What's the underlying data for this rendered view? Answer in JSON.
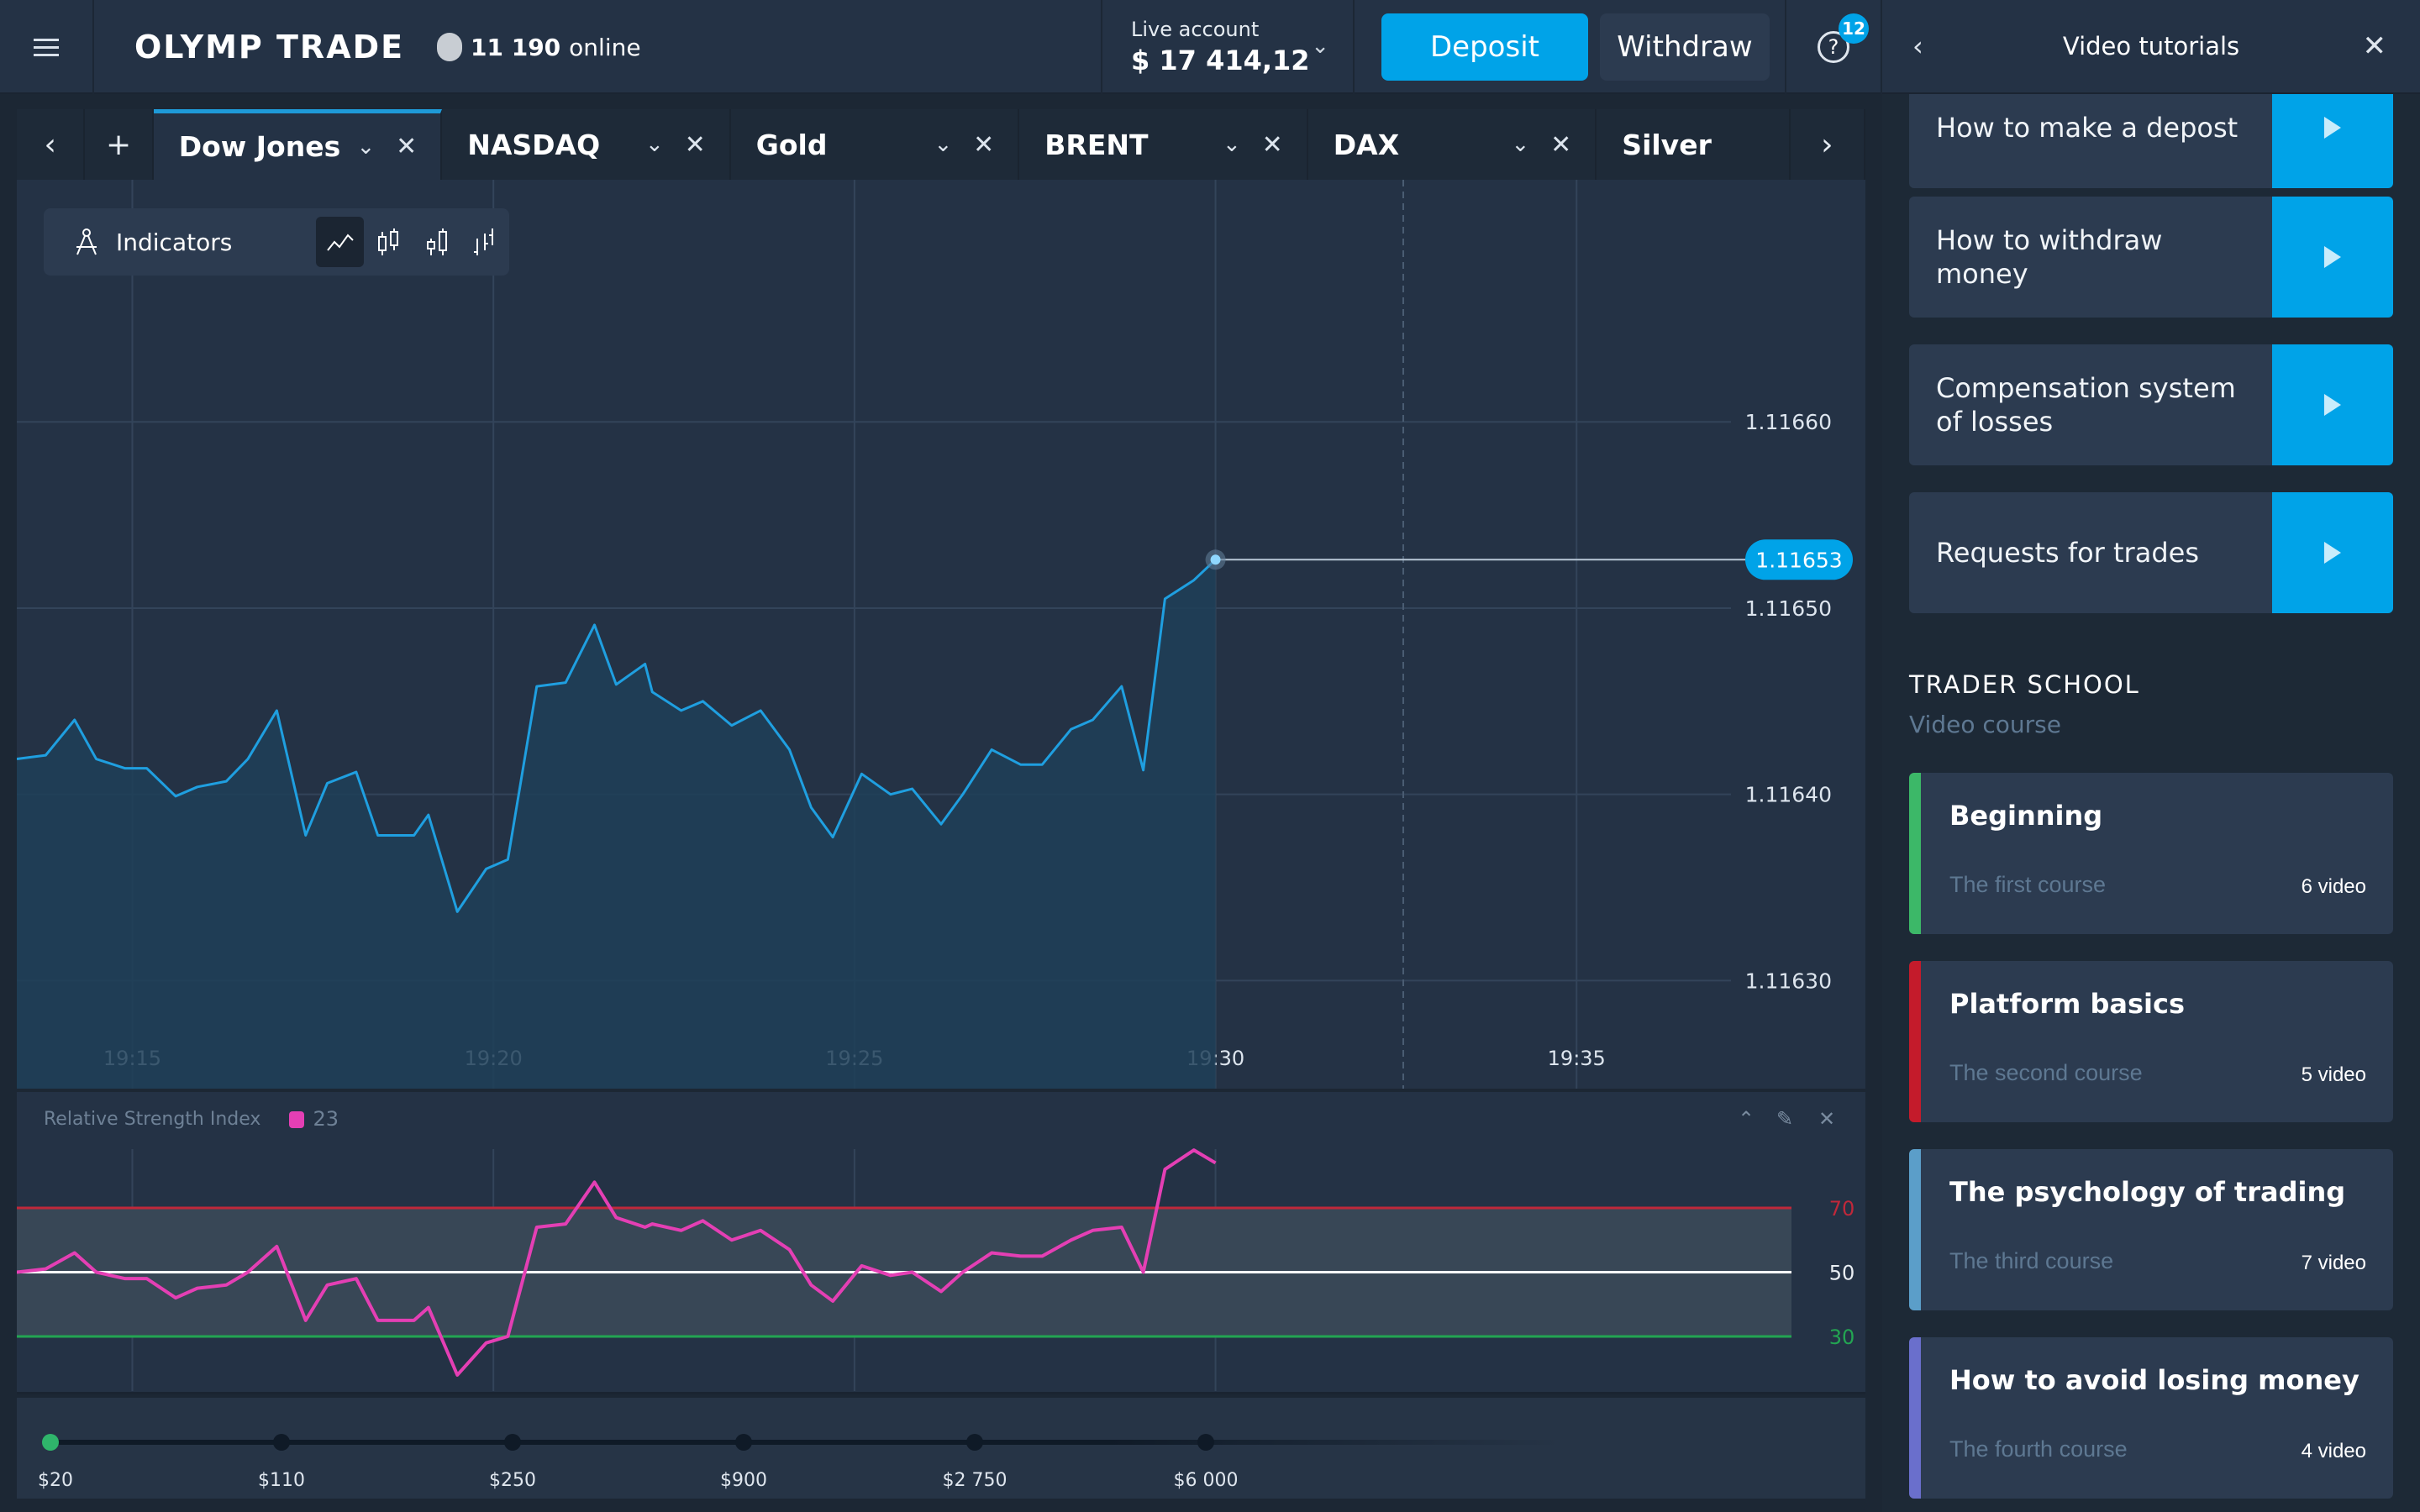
{
  "header": {
    "logo": "OLYMP TRADE",
    "online_count": "11 190",
    "online_label": "online",
    "account_label": "Live account",
    "balance": "$ 17 414,12",
    "deposit_label": "Deposit",
    "withdraw_label": "Withdraw",
    "help_badge": "12"
  },
  "tabs": [
    {
      "label": "Dow Jones",
      "active": true
    },
    {
      "label": "NASDAQ",
      "active": false
    },
    {
      "label": "Gold",
      "active": false
    },
    {
      "label": "BRENT",
      "active": false
    },
    {
      "label": "DAX",
      "active": false
    },
    {
      "label": "Silver",
      "active": false
    }
  ],
  "toolbar": {
    "indicators_label": "Indicators",
    "chart_types": [
      "line",
      "candles",
      "candles-alt",
      "bars"
    ],
    "selected_type": "line"
  },
  "chart_data": [
    {
      "type": "area",
      "title": "Dow Jones",
      "xlabel": "",
      "ylabel": "",
      "x_unit": "minutes after 19:00",
      "x": [
        13.4,
        13.8,
        14.2,
        14.5,
        14.9,
        15.2,
        15.6,
        15.9,
        16.3,
        16.6,
        17.0,
        17.4,
        17.7,
        18.1,
        18.4,
        18.9,
        19.1,
        19.5,
        19.9,
        20.2,
        20.6,
        21.0,
        21.4,
        21.7,
        22.1,
        22.2,
        22.6,
        22.9,
        23.3,
        23.7,
        24.1,
        24.4,
        24.7,
        25.1,
        25.5,
        25.8,
        26.2,
        26.5,
        26.9,
        27.3,
        27.6,
        28.0,
        28.3,
        28.7,
        29.0,
        29.3,
        29.7,
        30.0
      ],
      "y": [
        1.116419,
        1.116421,
        1.11644,
        1.116419,
        1.116414,
        1.116414,
        1.116399,
        1.116404,
        1.116407,
        1.116419,
        1.116445,
        1.116378,
        1.116406,
        1.116412,
        1.116378,
        1.116378,
        1.116389,
        1.116337,
        1.11636,
        1.116365,
        1.116458,
        1.11646,
        1.116491,
        1.116459,
        1.11647,
        1.116455,
        1.116445,
        1.11645,
        1.116437,
        1.116445,
        1.116424,
        1.116393,
        1.116377,
        1.116411,
        1.1164,
        1.116403,
        1.116384,
        1.1164,
        1.116424,
        1.116416,
        1.116416,
        1.116435,
        1.11644,
        1.116458,
        1.116413,
        1.116505,
        1.116515,
        1.116526,
        1.116519
      ],
      "current_price": "1.11653",
      "yticks": [
        "1.11660",
        "1.11650",
        "1.11640",
        "1.11630"
      ],
      "ytick_values": [
        1.1166,
        1.1165,
        1.1164,
        1.1163
      ],
      "xticks": [
        "19:15",
        "19:20",
        "19:25",
        "19:30",
        "19:35"
      ],
      "xtick_values": [
        15,
        20,
        25,
        30,
        35
      ],
      "xlim": [
        13.4,
        39.0
      ],
      "ylim": [
        1.116242,
        1.11673
      ],
      "expiry_marker_x": 32.6,
      "grid": true,
      "color": "#1f9fe0"
    },
    {
      "type": "line",
      "title": "Relative Strength Index",
      "period": "23",
      "x_unit": "minutes after 19:00",
      "x": [
        13.4,
        13.8,
        14.2,
        14.5,
        14.9,
        15.2,
        15.6,
        15.9,
        16.3,
        16.6,
        17.0,
        17.4,
        17.7,
        18.1,
        18.4,
        18.9,
        19.1,
        19.5,
        19.9,
        20.2,
        20.6,
        21.0,
        21.4,
        21.7,
        22.1,
        22.2,
        22.6,
        22.9,
        23.3,
        23.7,
        24.1,
        24.4,
        24.7,
        25.1,
        25.5,
        25.8,
        26.2,
        26.5,
        26.9,
        27.3,
        27.6,
        28.0,
        28.3,
        28.7,
        29.0,
        29.3,
        29.7,
        30.0
      ],
      "y": [
        50,
        51,
        56,
        50,
        48,
        48,
        42,
        45,
        46,
        50,
        58,
        35,
        46,
        48,
        35,
        35,
        39,
        18,
        28,
        30,
        64,
        65,
        78,
        67,
        64,
        65,
        63,
        66,
        60,
        63,
        57,
        46,
        41,
        52,
        49,
        50,
        44,
        50,
        56,
        55,
        55,
        60,
        63,
        64,
        50,
        82,
        88,
        84
      ],
      "levels": [
        {
          "value": 70,
          "color": "#c0283a"
        },
        {
          "value": 50,
          "color": "#ffffff"
        },
        {
          "value": 30,
          "color": "#23a552"
        }
      ],
      "yticks": [
        "70",
        "50",
        "30"
      ],
      "ylim": [
        0,
        100
      ],
      "color": "#e43fb4"
    }
  ],
  "rsi": {
    "title": "Relative Strength Index",
    "period": "23",
    "swatch_color": "#e43fb4"
  },
  "amount_slider": {
    "steps": [
      "$20",
      "$110",
      "$250",
      "$900",
      "$2 750",
      "$6 000"
    ],
    "selected_index": 0
  },
  "panel": {
    "title": "Video tutorials",
    "videos": [
      {
        "title": "How to make a depost"
      },
      {
        "title": "How to withdraw money"
      },
      {
        "title": "Compensation system of losses"
      },
      {
        "title": "Requests for trades"
      }
    ],
    "school_title": "TRADER SCHOOL",
    "school_subtitle": "Video course",
    "courses": [
      {
        "title": "Beginning",
        "subtitle": "The first course",
        "count": "6 video",
        "color": "#3cb868"
      },
      {
        "title": "Platform basics",
        "subtitle": "The second course",
        "count": "5 video",
        "color": "#c41b2b"
      },
      {
        "title": "The psychology of trading",
        "subtitle": "The third course",
        "count": "7 video",
        "color": "#5b9ec9"
      },
      {
        "title": "How to avoid losing money",
        "subtitle": "The fourth course",
        "count": "4 video",
        "color": "#6a6fcc"
      }
    ]
  },
  "colors": {
    "accent": "#00a3e8",
    "background": "#1c2734",
    "surface": "#243245"
  }
}
